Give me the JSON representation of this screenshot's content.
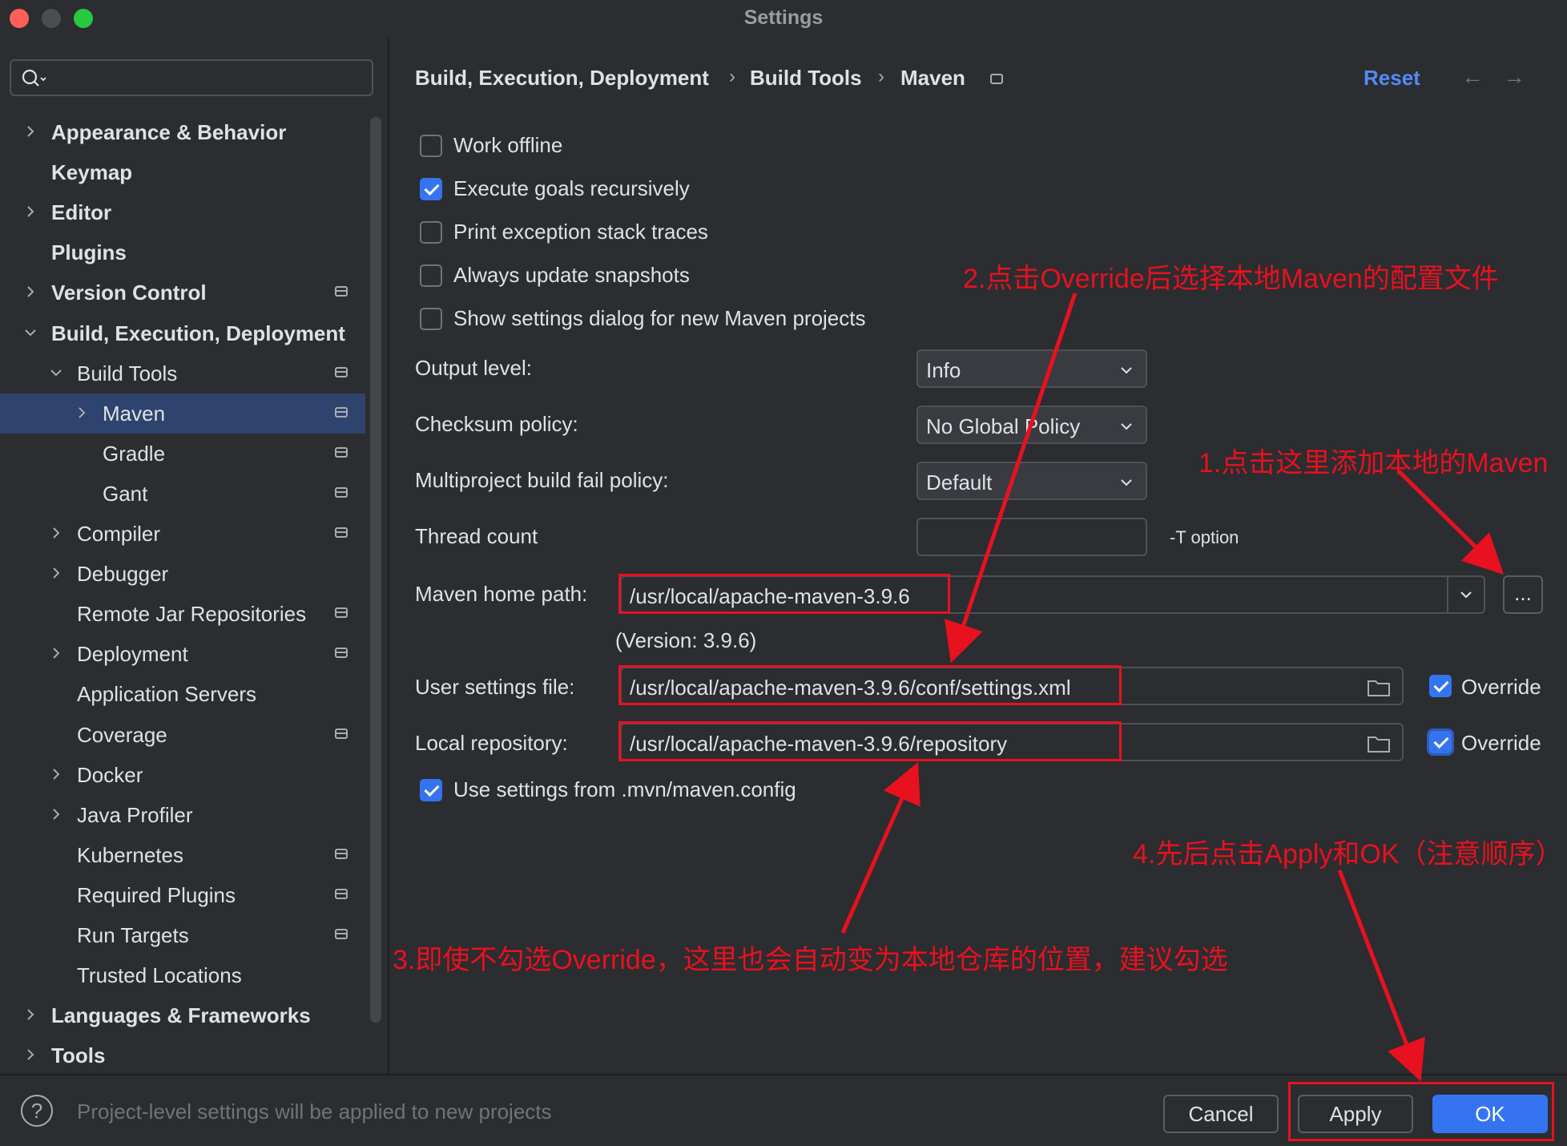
{
  "window": {
    "title": "Settings",
    "controls": {
      "close_color": "#ff5f57",
      "minimize_color": "#4b4d51",
      "zoom_color": "#28c840"
    }
  },
  "sidebar": {
    "search": {
      "placeholder": ""
    },
    "items": [
      {
        "label": "Appearance & Behavior",
        "level": 0,
        "expandable": true,
        "expanded": false,
        "bold": true,
        "pinned": false
      },
      {
        "label": "Keymap",
        "level": 0,
        "expandable": false,
        "bold": true,
        "pinned": false
      },
      {
        "label": "Editor",
        "level": 0,
        "expandable": true,
        "expanded": false,
        "bold": true,
        "pinned": false
      },
      {
        "label": "Plugins",
        "level": 0,
        "expandable": false,
        "bold": true,
        "pinned": false
      },
      {
        "label": "Version Control",
        "level": 0,
        "expandable": true,
        "expanded": false,
        "bold": true,
        "pinned": true
      },
      {
        "label": "Build, Execution, Deployment",
        "level": 0,
        "expandable": true,
        "expanded": true,
        "bold": true,
        "pinned": false
      },
      {
        "label": "Build Tools",
        "level": 1,
        "expandable": true,
        "expanded": true,
        "bold": false,
        "pinned": true
      },
      {
        "label": "Maven",
        "level": 2,
        "expandable": true,
        "expanded": false,
        "bold": false,
        "pinned": true,
        "selected": true
      },
      {
        "label": "Gradle",
        "level": 2,
        "expandable": false,
        "bold": false,
        "pinned": true
      },
      {
        "label": "Gant",
        "level": 2,
        "expandable": false,
        "bold": false,
        "pinned": true
      },
      {
        "label": "Compiler",
        "level": 1,
        "expandable": true,
        "expanded": false,
        "bold": false,
        "pinned": true
      },
      {
        "label": "Debugger",
        "level": 1,
        "expandable": true,
        "expanded": false,
        "bold": false,
        "pinned": false
      },
      {
        "label": "Remote Jar Repositories",
        "level": 1,
        "expandable": false,
        "bold": false,
        "pinned": true
      },
      {
        "label": "Deployment",
        "level": 1,
        "expandable": true,
        "expanded": false,
        "bold": false,
        "pinned": true
      },
      {
        "label": "Application Servers",
        "level": 1,
        "expandable": false,
        "bold": false,
        "pinned": false
      },
      {
        "label": "Coverage",
        "level": 1,
        "expandable": false,
        "bold": false,
        "pinned": true
      },
      {
        "label": "Docker",
        "level": 1,
        "expandable": true,
        "expanded": false,
        "bold": false,
        "pinned": false
      },
      {
        "label": "Java Profiler",
        "level": 1,
        "expandable": true,
        "expanded": false,
        "bold": false,
        "pinned": false
      },
      {
        "label": "Kubernetes",
        "level": 1,
        "expandable": false,
        "bold": false,
        "pinned": true
      },
      {
        "label": "Required Plugins",
        "level": 1,
        "expandable": false,
        "bold": false,
        "pinned": true
      },
      {
        "label": "Run Targets",
        "level": 1,
        "expandable": false,
        "bold": false,
        "pinned": true
      },
      {
        "label": "Trusted Locations",
        "level": 1,
        "expandable": false,
        "bold": false,
        "pinned": false
      },
      {
        "label": "Languages & Frameworks",
        "level": 0,
        "expandable": true,
        "expanded": false,
        "bold": true,
        "pinned": false
      },
      {
        "label": "Tools",
        "level": 0,
        "expandable": true,
        "expanded": false,
        "bold": true,
        "pinned": false
      }
    ]
  },
  "header": {
    "breadcrumb": [
      "Build, Execution, Deployment",
      "Build Tools",
      "Maven"
    ],
    "separator": "›",
    "reset_label": "Reset",
    "back_glyph": "←",
    "forward_glyph": "→"
  },
  "options": [
    {
      "label": "Work offline",
      "checked": false
    },
    {
      "label": "Execute goals recursively",
      "checked": true
    },
    {
      "label": "Print exception stack traces",
      "checked": false
    },
    {
      "label": "Always update snapshots",
      "checked": false
    },
    {
      "label": "Show settings dialog for new Maven projects",
      "checked": false
    }
  ],
  "form": {
    "output_level": {
      "label": "Output level:",
      "value": "Info"
    },
    "checksum_policy": {
      "label": "Checksum policy:",
      "value": "No Global Policy"
    },
    "fail_policy": {
      "label": "Multiproject build fail policy:",
      "value": "Default"
    },
    "thread_count": {
      "label": "Thread count",
      "value": "",
      "hint": "-T option"
    },
    "maven_home": {
      "label": "Maven home path:",
      "value": "/usr/local/apache-maven-3.9.6",
      "browse_label": "...",
      "version": "(Version: 3.9.6)"
    },
    "user_settings": {
      "label": "User settings file:",
      "value": "/usr/local/apache-maven-3.9.6/conf/settings.xml",
      "override_label": "Override",
      "override": true
    },
    "local_repo": {
      "label": "Local repository:",
      "value": "/usr/local/apache-maven-3.9.6/repository",
      "override_label": "Override",
      "override": true
    },
    "use_mvn_config": {
      "label": "Use settings from .mvn/maven.config",
      "checked": true
    }
  },
  "annotations": {
    "note1": "1.点击这里添加本地的Maven",
    "note2": "2.点击Override后选择本地Maven的配置文件",
    "note3": "3.即使不勾选Override，这里也会自动变为本地仓库的位置，建议勾选",
    "note4": "4.先后点击Apply和OK（注意顺序）",
    "color": "#e8111f"
  },
  "footer": {
    "help_glyph": "?",
    "status": "Project-level settings will be applied to new projects",
    "cancel_label": "Cancel",
    "apply_label": "Apply",
    "ok_label": "OK"
  },
  "colors": {
    "accent": "#3574f0",
    "selection": "#2e436e",
    "link": "#548af7",
    "background": "#2b2d30"
  }
}
